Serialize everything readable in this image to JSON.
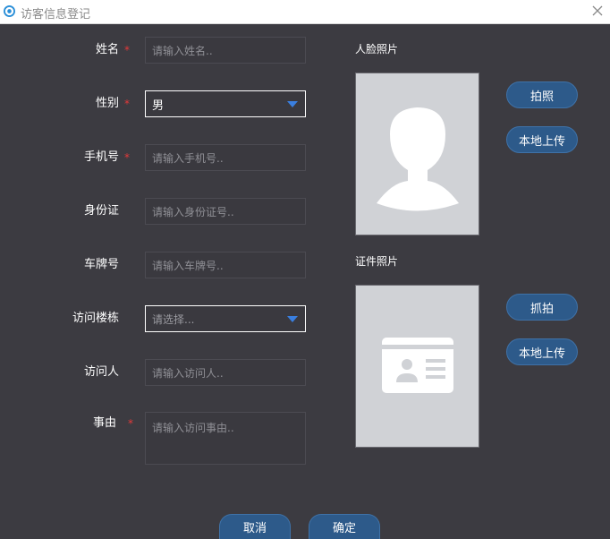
{
  "window": {
    "title": "访客信息登记"
  },
  "form": {
    "name": {
      "label": "姓名",
      "placeholder": "请输入姓名.."
    },
    "gender": {
      "label": "性别",
      "value": "男"
    },
    "phone": {
      "label": "手机号",
      "placeholder": "请输入手机号.."
    },
    "id_card": {
      "label": "身份证",
      "placeholder": "请输入身份证号.."
    },
    "plate": {
      "label": "车牌号",
      "placeholder": "请输入车牌号.."
    },
    "building": {
      "label": "访问楼栋",
      "placeholder": "请选择..."
    },
    "visitee": {
      "label": "访问人",
      "placeholder": "请输入访问人.."
    },
    "reason": {
      "label": "事由",
      "placeholder": "请输入访问事由.."
    },
    "required_mark": "*"
  },
  "face_photo": {
    "label": "人脸照片",
    "capture_button": "拍照",
    "upload_button": "本地上传"
  },
  "id_photo": {
    "label": "证件照片",
    "capture_button": "抓拍",
    "upload_button": "本地上传"
  },
  "footer": {
    "cancel_button": "取消",
    "confirm_button": "确定"
  },
  "colors": {
    "background": "#3c3b41",
    "button": "#2d5a8a",
    "required": "#e23a3a",
    "dropdown_caret": "#3a7fe0",
    "photo_placeholder": "#d0d2d6"
  }
}
